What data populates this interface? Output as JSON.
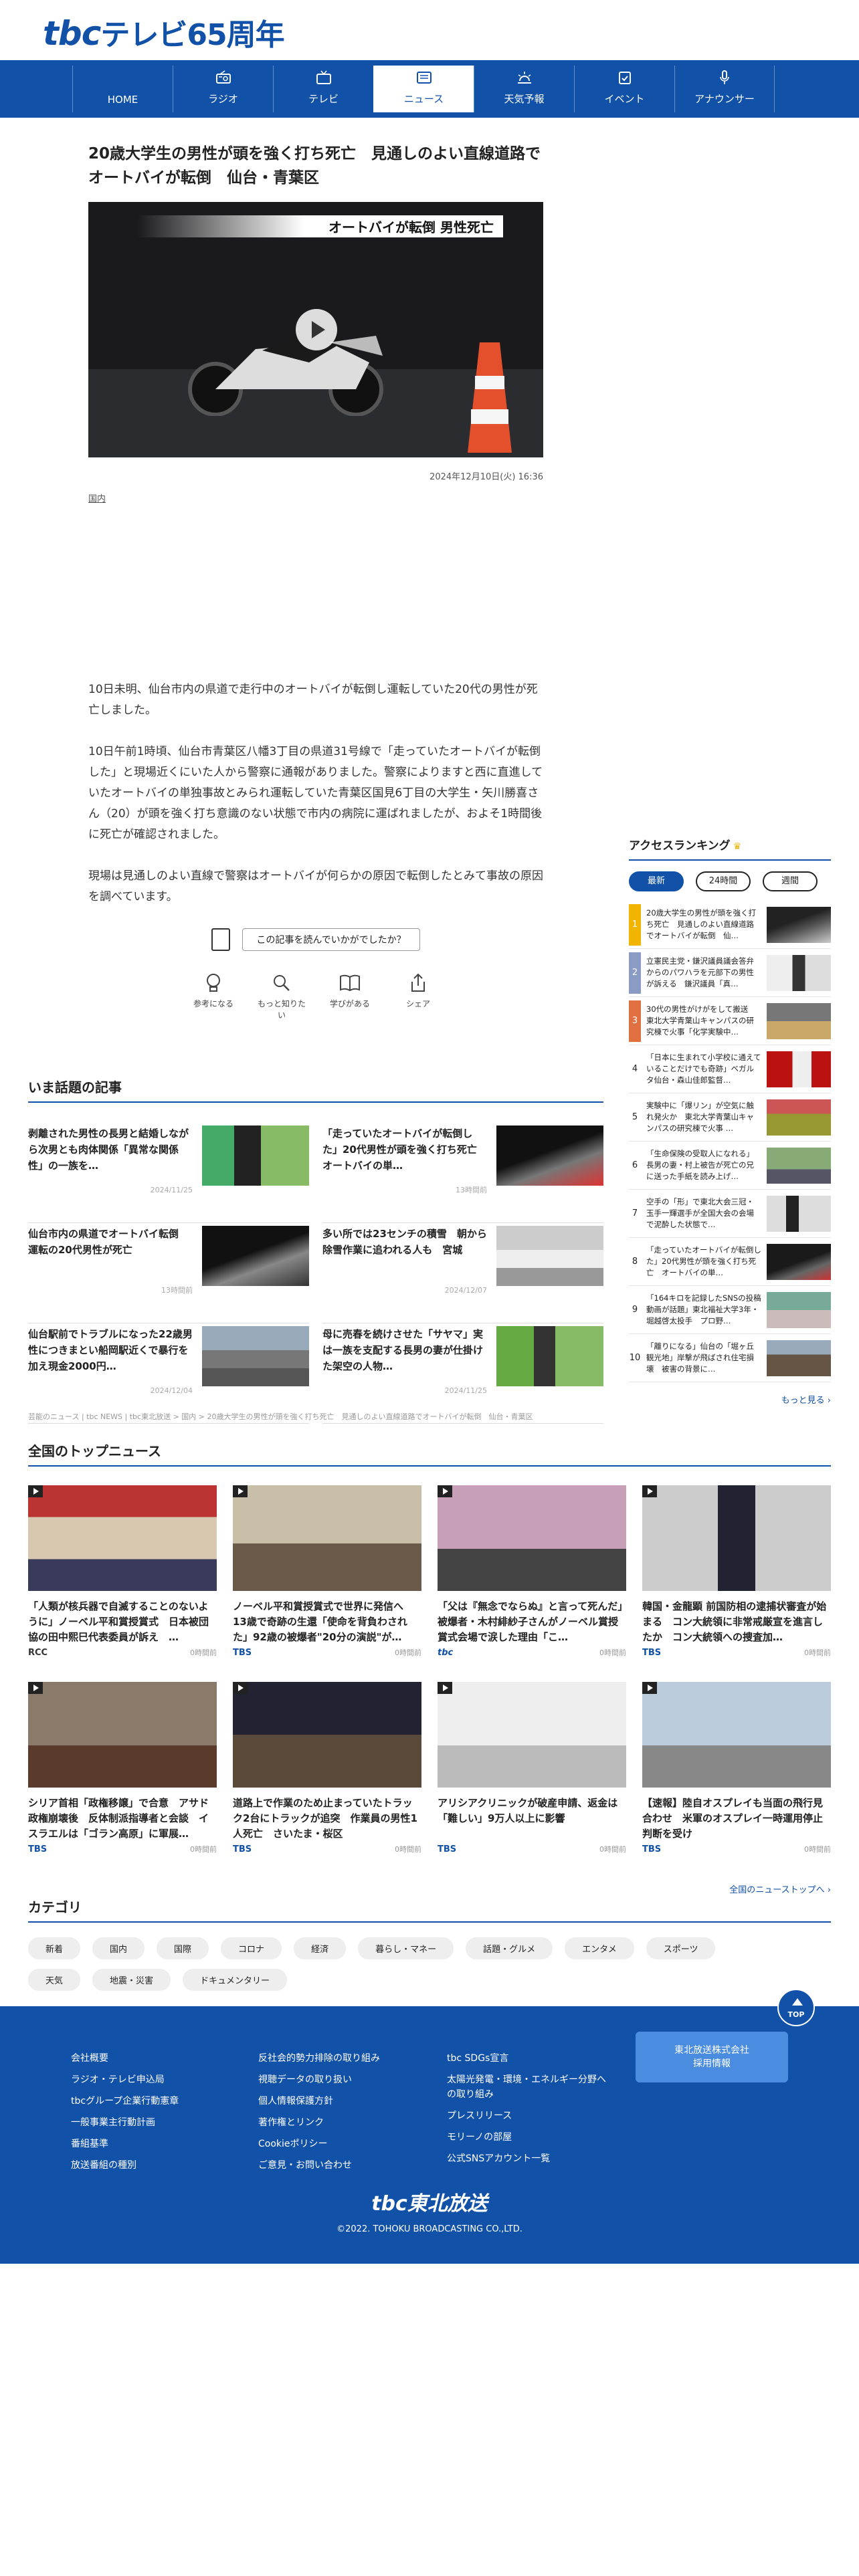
{
  "brand": {
    "logo_tbc": "tbc",
    "logo_rest": "テレビ65周年",
    "accent": "#1251a8"
  },
  "nav": [
    {
      "label": "HOME",
      "icon": "home-icon"
    },
    {
      "label": "ラジオ",
      "icon": "radio-icon"
    },
    {
      "label": "テレビ",
      "icon": "tv-icon"
    },
    {
      "label": "ニュース",
      "icon": "news-icon",
      "active": true
    },
    {
      "label": "天気予報",
      "icon": "weather-icon"
    },
    {
      "label": "イベント",
      "icon": "event-icon"
    },
    {
      "label": "アナウンサー",
      "icon": "microphone-icon"
    }
  ],
  "article": {
    "headline": "20歳大学生の男性が頭を強く打ち死亡　見通しのよい直線道路でオートバイが転倒　仙台・青葉区",
    "image_caption": "オートバイが転倒 男性死亡",
    "date": "2024年12月10日(火) 16:36",
    "tag": "国内",
    "paragraphs": [
      "10日未明、仙台市内の県道で走行中のオートバイが転倒し運転していた20代の男性が死亡しました。",
      "10日午前1時頃、仙台市青葉区八幡3丁目の県道31号線で「走っていたオートバイが転倒した」と現場近くにいた人から警察に通報がありました。警察によりますと西に直進していたオートバイの単独事故とみられ運転していた青葉区国見6丁目の大学生・矢川勝喜さん（20）が頭を強く打ち意識のない状態で市内の病院に運ばれましたが、およそ1時間後に死亡が確認されました。",
      "現場は見通しのよい直線で警察はオートバイが何らかの原因で転倒したとみて事故の原因を調べています。"
    ],
    "question": "この記事を読んでいかがでしたか？",
    "reactions": [
      {
        "label": "参考になる",
        "icon": "lightbulb-icon"
      },
      {
        "label": "もっと知りたい",
        "icon": "magnifier-icon"
      },
      {
        "label": "学びがある",
        "icon": "book-icon"
      },
      {
        "label": "シェア",
        "icon": "share-icon"
      }
    ]
  },
  "trending": {
    "title": "いま話題の記事",
    "items": [
      {
        "title": "剥離された男性の長男と結婚しながら次男とも肉体関係「異常な関係性」の一族を…",
        "time": "2024/11/25"
      },
      {
        "title": "「走っていたオートバイが転倒した」20代男性が頭を強く打ち死亡　オートバイの単…",
        "time": "13時間前"
      },
      {
        "title": "仙台市内の県道でオートバイ転倒　運転の20代男性が死亡",
        "time": "13時間前"
      },
      {
        "title": "多い所では23センチの積雪　朝から除雪作業に追われる人も　宮城",
        "time": "2024/12/07"
      },
      {
        "title": "仙台駅前でトラブルになった22歳男性につきまとい船岡駅近くで暴行を加え現金2000円…",
        "time": "2024/12/04"
      },
      {
        "title": "母に売春を続けさせた「サヤマ」実は一族を支配する長男の妻が仕掛けた架空の人物…",
        "time": "2024/11/25"
      }
    ]
  },
  "breadcrumb": "芸能のニュース | tbc NEWS | tbc東北放送 > 国内 > 20歳大学生の男性が頭を強く打ち死亡　見通しのよい直線道路でオートバイが転倒　仙台・青葉区",
  "ranking": {
    "title": "アクセスランキング",
    "tabs": [
      "最新",
      "24時間",
      "週間"
    ],
    "items": [
      "20歳大学生の男性が頭を強く打ち死亡　見通しのよい直線道路でオートバイが転倒　仙…",
      "立憲民主党・鎌沢議員議会答弁からのパワハラを元部下の男性が訴える　鎌沢議員「真…",
      "30代の男性がけがをして搬送　東北大学青葉山キャンパスの研究棟で火事「化学実験中…",
      "「日本に生まれて小学校に通えていることだけでも奇跡」ベガルタ仙台・森山佳郎監督…",
      "実験中に「爆リン」が空気に触れ発火か　東北大学青葉山キャンパスの研究棟で火事 …",
      "「生命保険の受取人になれる」長男の妻・村上被告が死亡の兄に送った手紙を読み上げ…",
      "空手の「形」で東北大会三冠・玉手一輝選手が全国大会の会場で泥酔した状態で…",
      "「走っていたオートバイが転倒した」20代男性が頭を強く打ち死亡　オートバイの単…",
      "「164キロを記録したSNSの投稿動画が話題」東北福祉大学3年・堀越啓太投手　プロ野…",
      "「離りになる」仙台の「堀ヶ丘観光地」岸撃が飛ばされ住宅損壊　被害の背景に…"
    ],
    "more": "もっと見る"
  },
  "top_news": {
    "title": "全国のトップニュース",
    "items": [
      {
        "title": "「人類が核兵器で自滅することのないように」ノーベル平和賞授賞式　日本被団協の田中熙巳代表委員が訴え　…",
        "source": "RCC",
        "time": "0時間前"
      },
      {
        "title": "ノーベル平和賞授賞式で世界に発信へ　13歳で奇跡の生還「使命を背負わされた」92歳の被爆者\"20分の演説\"が…",
        "source": "TBS",
        "time": "0時間前"
      },
      {
        "title": "「父は『無念でならぬ』と言って死んだ」被爆者・木村緋紗子さんがノーベル賞授賞式会場で涙した理由「こ…",
        "source": "tbc",
        "time": "0時間前"
      },
      {
        "title": "韓国・金龍顕 前国防相の逮捕状審査が始まる　コン大統領に非常戒厳宣を進言したか　コン大統領への捜査加…",
        "source": "TBS",
        "time": "0時間前"
      },
      {
        "title": "シリア首相「政権移譲」で合意　アサド政権崩壊後　反体制派指導者と会談　イスラエルは「ゴラン高原」に軍展…",
        "source": "TBS",
        "time": "0時間前"
      },
      {
        "title": "道路上で作業のため止まっていたトラック2台にトラックが追突　作業員の男性1人死亡　さいたま・桜区",
        "source": "TBS",
        "time": "0時間前"
      },
      {
        "title": "アリシアクリニックが破産申請、返金は「難しい」9万人以上に影響",
        "source": "TBS",
        "time": "0時間前"
      },
      {
        "title": "【速報】陸自オスプレイも当面の飛行見合わせ　米軍のオスプレイ一時運用停止判断を受け",
        "source": "TBS",
        "time": "0時間前"
      }
    ],
    "more": "全国のニューストップへ"
  },
  "categories": {
    "title": "カテゴリ",
    "items": [
      "新着",
      "国内",
      "国際",
      "コロナ",
      "経済",
      "暮らし・マネー",
      "話題・グルメ",
      "エンタメ",
      "スポーツ",
      "天気",
      "地震・災害",
      "ドキュメンタリー"
    ]
  },
  "footer": {
    "top": "TOP",
    "col1": [
      "会社概要",
      "ラジオ・テレビ申込局",
      "tbcグループ企業行動憲章",
      "一般事業主行動計画",
      "番組基準",
      "放送番組の種別"
    ],
    "col2": [
      "反社会的勢力排除の取り組み",
      "視聴データの取り扱い",
      "個人情報保護方針",
      "著作権とリンク",
      "Cookieポリシー",
      "ご意見・お問い合わせ"
    ],
    "col3": [
      "tbc SDGs宣言",
      "太陽光発電・環境・エネルギー分野への取り組み",
      "プレスリリース",
      "モリーノの部屋",
      "公式SNSアカウント一覧"
    ],
    "recruit": "東北放送株式会社\n採用情報",
    "logo": "tbc東北放送",
    "copyright": "©2022. TOHOKU BROADCASTING CO.,LTD."
  }
}
